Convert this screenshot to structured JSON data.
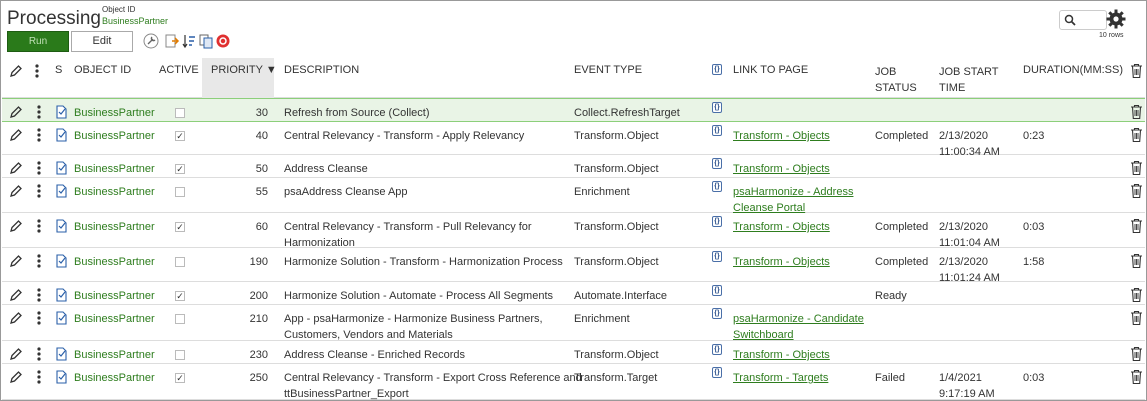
{
  "header": {
    "title": "Processing",
    "object_id_label": "Object ID",
    "object_id_value": "BusinessPartner",
    "run_label": "Run",
    "edit_label": "Edit",
    "rows_label": "10 rows"
  },
  "columns": {
    "s": "S",
    "object_id": "OBJECT ID",
    "active": "ACTIVE",
    "priority": "PRIORITY",
    "priority_sort": "▼",
    "description": "DESCRIPTION",
    "event_type": "EVENT TYPE",
    "link_to_page": "LINK TO PAGE",
    "job_status_1": "JOB",
    "job_status_2": "STATUS",
    "job_start_1": "JOB START",
    "job_start_2": "TIME",
    "duration": "DURATION(MM:SS)"
  },
  "rows": [
    {
      "object_id": "BusinessPartner",
      "active": false,
      "priority": "30",
      "desc1": "Refresh from Source (Collect)",
      "desc2": "",
      "event_type": "Collect.RefreshTarget",
      "link1": "",
      "link2": "",
      "status": "",
      "start1": "",
      "start2": "",
      "duration": ""
    },
    {
      "object_id": "BusinessPartner",
      "active": true,
      "priority": "40",
      "desc1": "Central Relevancy - Transform - Apply Relevancy",
      "desc2": "",
      "event_type": "Transform.Object",
      "link1": "Transform - Objects",
      "link2": "",
      "status": "Completed",
      "start1": "2/13/2020",
      "start2": "11:00:34 AM",
      "duration": "0:23"
    },
    {
      "object_id": "BusinessPartner",
      "active": true,
      "priority": "50",
      "desc1": "Address Cleanse",
      "desc2": "",
      "event_type": "Transform.Object",
      "link1": "Transform - Objects",
      "link2": "",
      "status": "",
      "start1": "",
      "start2": "",
      "duration": ""
    },
    {
      "object_id": "BusinessPartner",
      "active": false,
      "priority": "55",
      "desc1": "psaAddress Cleanse App",
      "desc2": "",
      "event_type": "Enrichment",
      "link1": "psaHarmonize - Address",
      "link2": "Cleanse Portal",
      "status": "",
      "start1": "",
      "start2": "",
      "duration": ""
    },
    {
      "object_id": "BusinessPartner",
      "active": true,
      "priority": "60",
      "desc1": "Central Relevancy - Transform - Pull Relevancy for",
      "desc2": "Harmonization",
      "event_type": "Transform.Object",
      "link1": "Transform - Objects",
      "link2": "",
      "status": "Completed",
      "start1": "2/13/2020",
      "start2": "11:01:04 AM",
      "duration": "0:03"
    },
    {
      "object_id": "BusinessPartner",
      "active": false,
      "priority": "190",
      "desc1": "Harmonize Solution - Transform - Harmonization Process",
      "desc2": "",
      "event_type": "Transform.Object",
      "link1": "Transform - Objects",
      "link2": "",
      "status": "Completed",
      "start1": "2/13/2020",
      "start2": "11:01:24 AM",
      "duration": "1:58"
    },
    {
      "object_id": "BusinessPartner",
      "active": true,
      "priority": "200",
      "desc1": "Harmonize Solution - Automate - Process All Segments",
      "desc2": "",
      "event_type": "Automate.Interface",
      "link1": "",
      "link2": "",
      "status": "Ready",
      "start1": "",
      "start2": "",
      "duration": ""
    },
    {
      "object_id": "BusinessPartner",
      "active": false,
      "priority": "210",
      "desc1": "App - psaHarmonize - Harmonize Business Partners,",
      "desc2": "Customers, Vendors and Materials",
      "event_type": "Enrichment",
      "link1": "psaHarmonize - Candidate",
      "link2": "Switchboard",
      "status": "",
      "start1": "",
      "start2": "",
      "duration": ""
    },
    {
      "object_id": "BusinessPartner",
      "active": false,
      "priority": "230",
      "desc1": "Address Cleanse - Enriched Records",
      "desc2": "",
      "event_type": "Transform.Object",
      "link1": "Transform - Objects",
      "link2": "",
      "status": "",
      "start1": "",
      "start2": "",
      "duration": ""
    },
    {
      "object_id": "BusinessPartner",
      "active": true,
      "priority": "250",
      "desc1": "Central Relevancy - Transform - Export Cross Reference and",
      "desc2": "ttBusinessPartner_Export",
      "event_type": "Transform.Target",
      "link1": "Transform - Targets",
      "link2": "",
      "status": "Failed",
      "start1": "1/4/2021",
      "start2": "9:17:19 AM",
      "duration": "0:03"
    }
  ],
  "checkmark": "✓",
  "json_glyph": "{}",
  "icons": {
    "toolbar": [
      "wrench-icon",
      "export-icon",
      "sort-icon",
      "copy-icon",
      "stop-icon"
    ],
    "row": [
      "pencil-icon",
      "kebab-icon",
      "status-doc-icon",
      "json-icon",
      "trash-icon"
    ],
    "header": [
      "search-icon",
      "gear-icon"
    ]
  },
  "colors": {
    "accent_green": "#2a7a1a",
    "link_green": "#2e7d1e",
    "highlight_row": "#e9f4e6"
  }
}
